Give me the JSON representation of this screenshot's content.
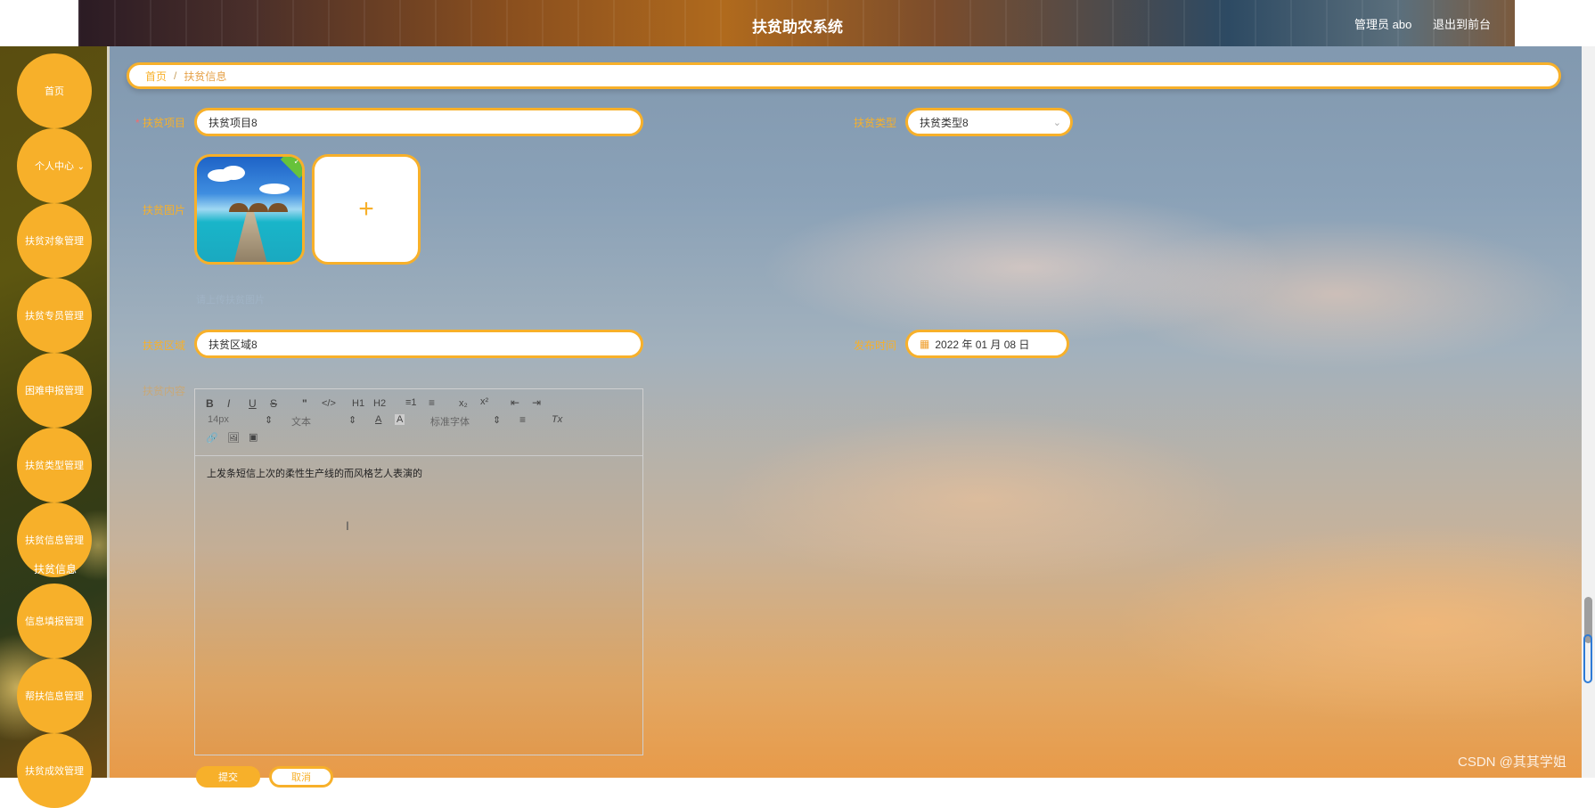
{
  "header": {
    "title": "扶贫助农系统",
    "user": "管理员 abo",
    "logout": "退出到前台"
  },
  "sidebar": {
    "items": [
      {
        "label": "首页"
      },
      {
        "label": "个人中心"
      },
      {
        "label": "扶贫对象管理"
      },
      {
        "label": "扶贫专员管理"
      },
      {
        "label": "困难申报管理"
      },
      {
        "label": "扶贫类型管理"
      },
      {
        "label": "扶贫信息管理"
      },
      {
        "label": "信息填报管理"
      },
      {
        "label": "帮扶信息管理"
      },
      {
        "label": "扶贫成效管理"
      }
    ],
    "submenu_item": "扶贫信息"
  },
  "breadcrumb": {
    "home": "首页",
    "separator": "/",
    "current": "扶贫信息"
  },
  "form": {
    "project": {
      "label": "扶贫项目",
      "required": "*",
      "value": "扶贫项目8"
    },
    "type": {
      "label": "扶贫类型",
      "value": "扶贫类型8"
    },
    "image": {
      "label": "扶贫图片",
      "add_icon": "+",
      "tip": "请上传扶贫图片"
    },
    "area": {
      "label": "扶贫区域",
      "value": "扶贫区域8"
    },
    "date": {
      "label": "发布时间",
      "value": "2022 年 01 月 08 日"
    },
    "content": {
      "label": "扶贫内容",
      "value": "上发条短信上次的柔性生产线的而风格艺人表演的"
    }
  },
  "editor_toolbar": {
    "font_size": "14px",
    "text_format": "文本",
    "font_family": "标准字体",
    "buttons": [
      "B",
      "I",
      "U",
      "S",
      "\"",
      "</>",
      "H1",
      "H2",
      "≡1",
      "≡",
      "x₂",
      "x²",
      "⇤",
      "⇥",
      "A",
      "A",
      "≡",
      "Tx",
      "🔗",
      "🖼",
      "▣"
    ]
  },
  "actions": {
    "submit": "提交",
    "cancel": "取消"
  },
  "watermark": "CSDN @其其学姐",
  "colors": {
    "accent": "#f7b02a",
    "required": "#f56c6c"
  }
}
